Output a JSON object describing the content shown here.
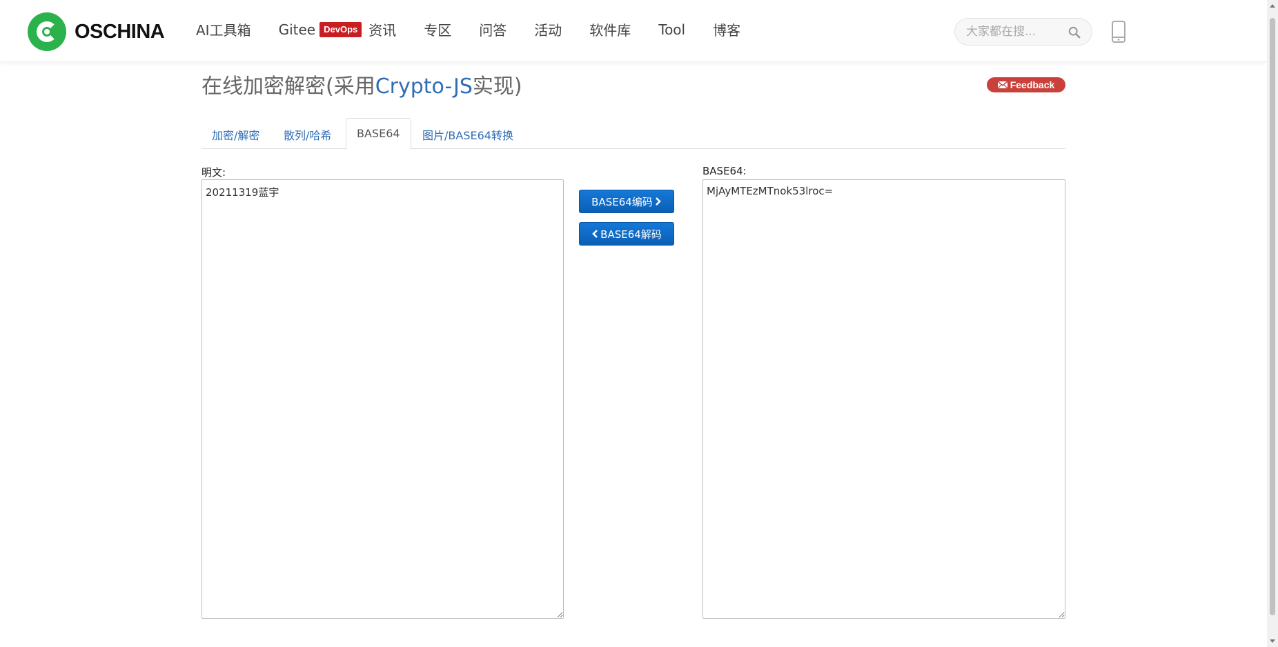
{
  "brand": {
    "name": "OSCHINA",
    "logo_color": "#2bb24c"
  },
  "nav": {
    "items": [
      {
        "label": "AI工具箱"
      },
      {
        "label": "Gitee",
        "badge": "DevOps"
      },
      {
        "label": "资讯"
      },
      {
        "label": "专区"
      },
      {
        "label": "问答"
      },
      {
        "label": "活动"
      },
      {
        "label": "软件库"
      },
      {
        "label": "Tool"
      },
      {
        "label": "博客"
      }
    ],
    "search_placeholder": "大家都在搜...",
    "search_icon": "search-icon",
    "mobile_icon": "mobile-phone-icon"
  },
  "page": {
    "title_prefix": "在线加密解密(采用",
    "title_accent": "Crypto-JS",
    "title_suffix": "实现)",
    "feedback_label": "Feedback",
    "accent_color": "#2f6db5"
  },
  "tabs": [
    {
      "label": "加密/解密",
      "active": false
    },
    {
      "label": "散列/哈希",
      "active": false
    },
    {
      "label": "BASE64",
      "active": true
    },
    {
      "label": "图片/BASE64转换",
      "active": false
    }
  ],
  "form": {
    "plain_label": "明文:",
    "plain_value": "20211319蓝宇",
    "base64_label": "BASE64:",
    "base64_value": "MjAyMTEzMTnok53lroc=",
    "encode_label": "BASE64编码",
    "decode_label": "BASE64解码",
    "button_color": "#1578d6"
  }
}
